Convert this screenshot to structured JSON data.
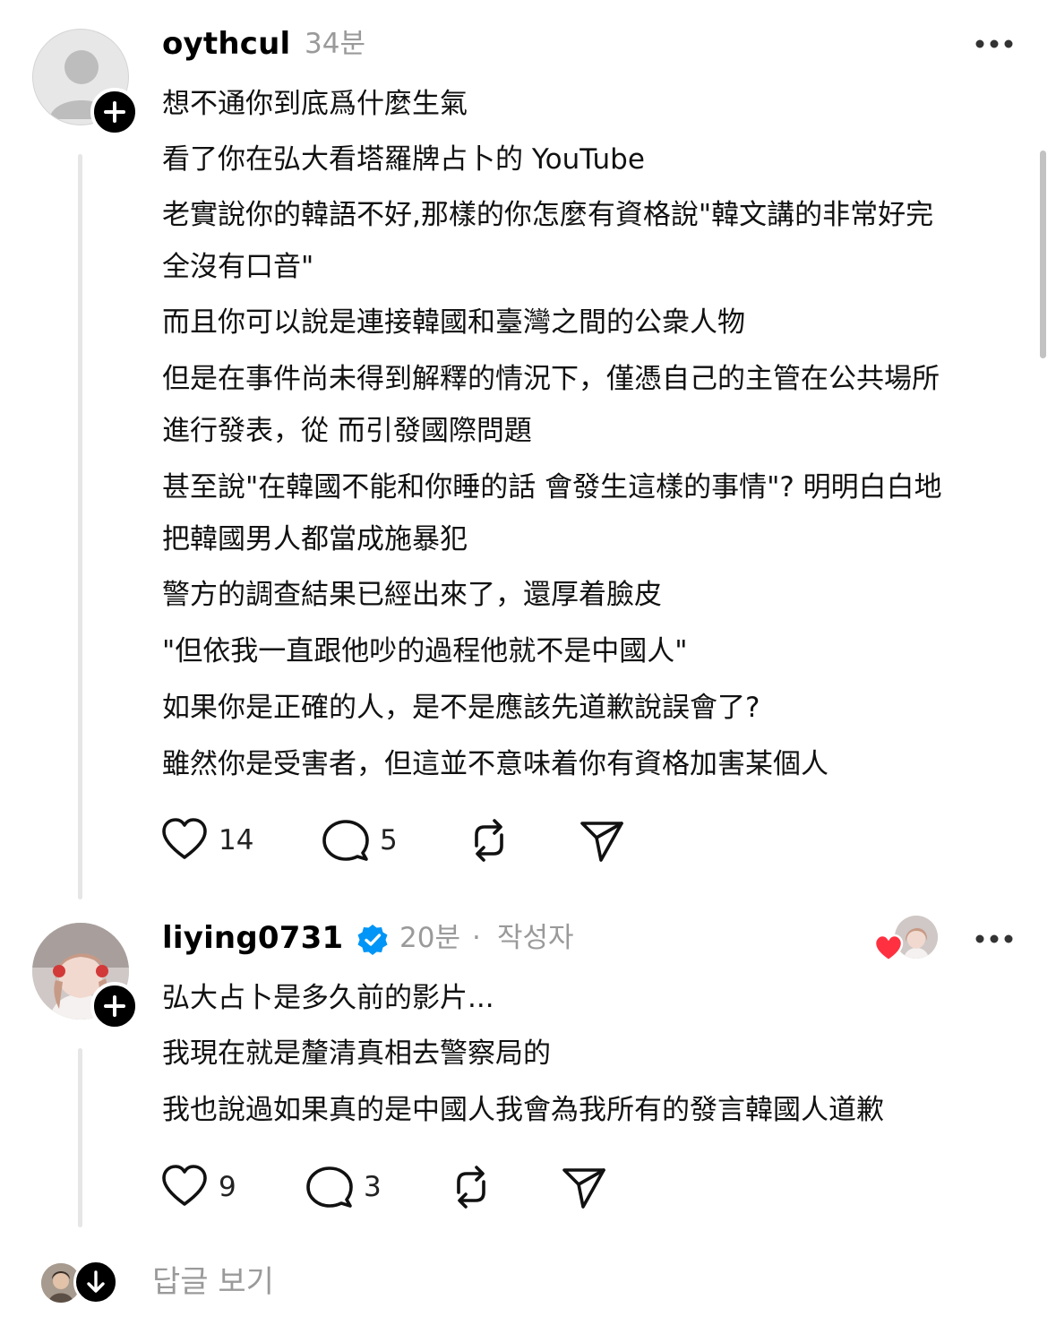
{
  "comment1": {
    "username": "oythcul",
    "time": "34분",
    "lines": [
      "想不通你到底爲什麼生氣",
      "看了你在弘大看塔羅牌占卜的 YouTube",
      "老實說你的韓語不好,那樣的你怎麼有資格說\"韓文講的非常好完",
      "全沒有口音\"",
      "而且你可以說是連接韓國和臺灣之間的公衆人物",
      "但是在事件尚未得到解釋的情況下，僅憑自己的主管在公共場所",
      "進行發表，從  而引發國際問題",
      "甚至說\"在韓國不能和你睡的話 會發生這樣的事情\"? 明明白白地",
      "把韓國男人都當成施暴犯",
      "警方的調查結果已經出來了，還厚着臉皮",
      "\"但依我一直跟他吵的過程他就不是中國人\"",
      "如果你是正確的人，是不是應該先道歉說誤會了?",
      "雖然你是受害者，但這並不意味着你有資格加害某個人"
    ],
    "likes": "14",
    "replies": "5"
  },
  "comment2": {
    "username": "liying0731",
    "time": "20분",
    "separator": "·",
    "author_label": "작성자",
    "lines": [
      "弘大占卜是多久前的影片...",
      "我現在就是釐清真相去警察局的",
      "我也說過如果真的是中國人我會為我所有的發言韓國人道歉"
    ],
    "likes": "9",
    "replies": "3"
  },
  "footer": {
    "view_replies": "답글 보기"
  },
  "colors": {
    "verified": "#0095f6",
    "heart": "#ff3040",
    "muted": "#9a9a9a"
  }
}
